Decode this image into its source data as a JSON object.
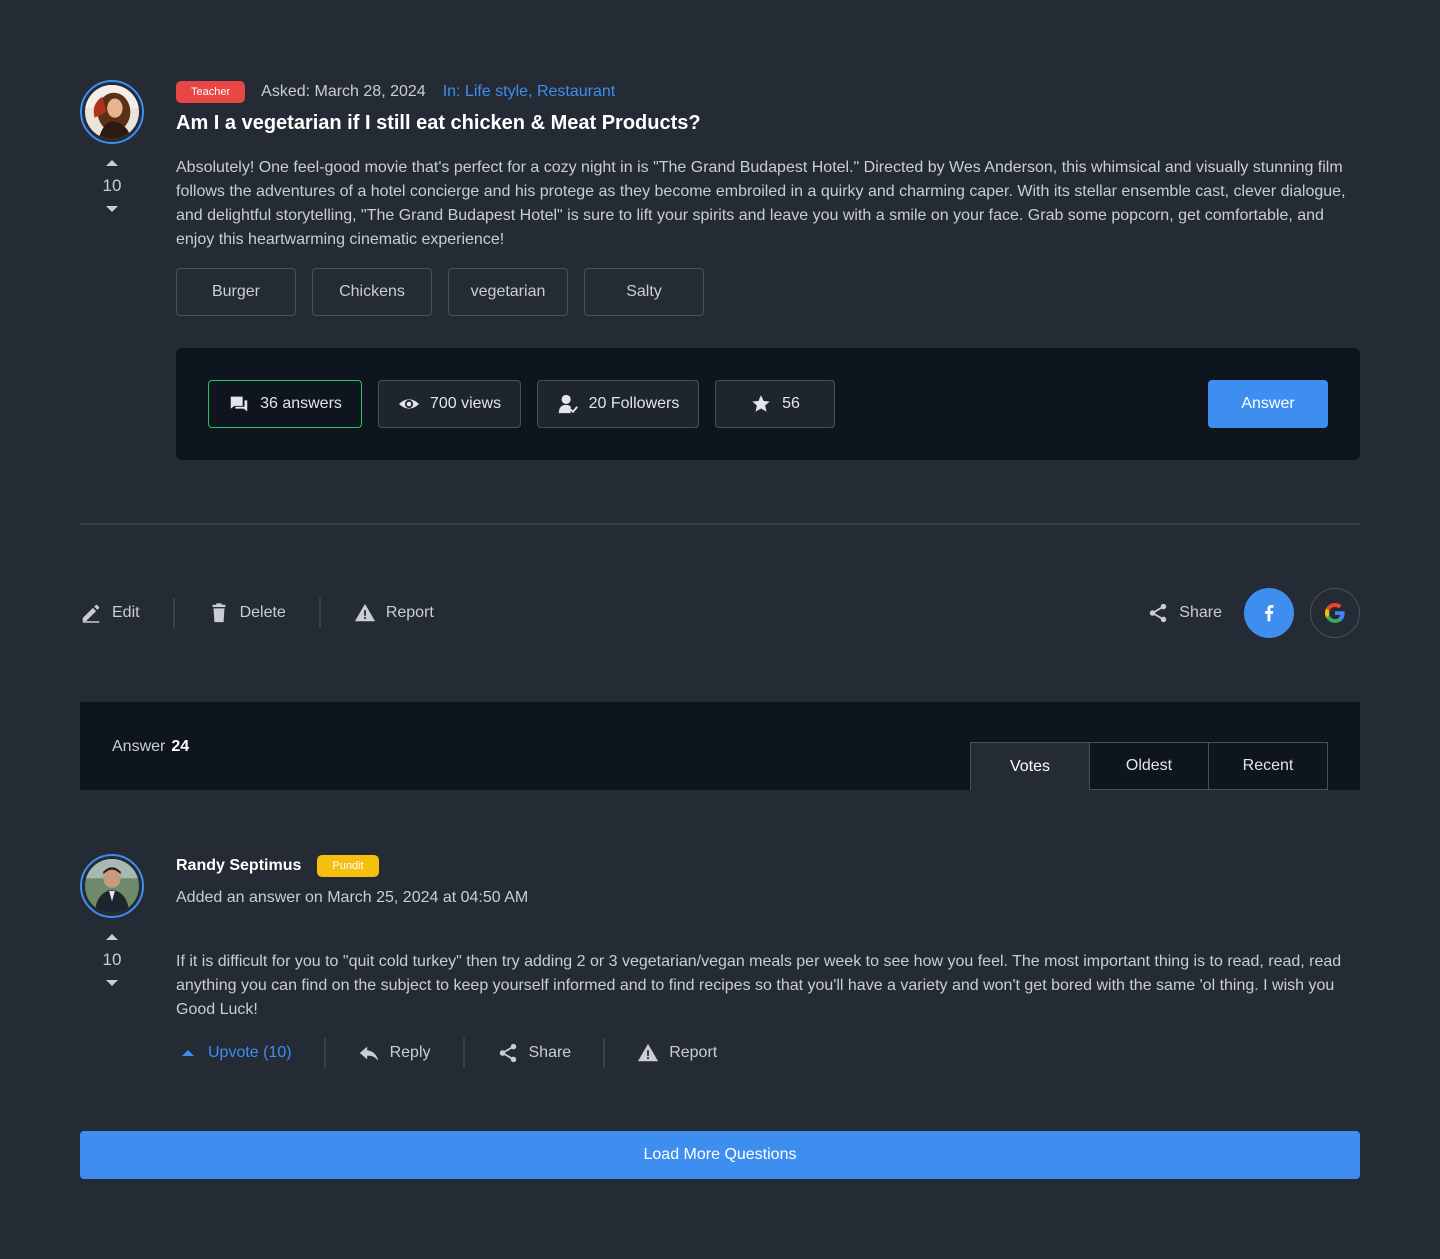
{
  "question": {
    "badge": "Teacher",
    "asked": "Asked: March 28, 2024",
    "categories": "In: Life style, Restaurant",
    "title": "Am I a vegetarian if I still eat chicken & Meat Products?",
    "body": "Absolutely! One feel-good movie that's perfect for a cozy night in is \"The Grand Budapest Hotel.\" Directed by Wes Anderson, this whimsical and visually stunning film follows the adventures of a hotel concierge and his protege as they become embroiled in a quirky and charming caper. With its stellar ensemble cast, clever dialogue, and delightful storytelling, \"The Grand Budapest Hotel\" is sure to lift your spirits and leave you with a smile on your face. Grab some popcorn, get comfortable, and enjoy this heartwarming cinematic experience!",
    "votes": "10",
    "tags": [
      "Burger",
      "Chickens",
      "vegetarian",
      "Salty"
    ]
  },
  "stats": {
    "answers": "36 answers",
    "views": "700 views",
    "followers": "20 Followers",
    "stars": "56",
    "answer_button": "Answer"
  },
  "actions": {
    "edit": "Edit",
    "delete": "Delete",
    "report": "Report",
    "share": "Share"
  },
  "answers_header": {
    "label": "Answer",
    "count": "24",
    "tabs": [
      "Votes",
      "Oldest",
      "Recent"
    ],
    "active_tab": "Votes"
  },
  "answer": {
    "name": "Randy Septimus",
    "badge": "Pundit",
    "date": "Added an answer on March 25, 2024 at 04:50 AM",
    "votes": "10",
    "body": "If it is difficult for you to \"quit cold turkey\" then try adding 2 or 3 vegetarian/vegan meals per week to see how you feel. The most important thing is to read, read, read anything you can find on the subject to keep yourself informed and to find recipes so that you'll have a variety and won't get bored with the same 'ol thing. I wish you Good Luck!",
    "upvote": "Upvote (10)",
    "reply": "Reply",
    "share": "Share",
    "report": "Report"
  },
  "load_more": "Load More Questions",
  "colors": {
    "background": "#252b35",
    "panel": "#0f151e",
    "accent": "#3e8ef0",
    "teacher_badge": "#e84545",
    "pundit_badge": "#f5bf0f",
    "active_stat_border": "#22c55e"
  }
}
